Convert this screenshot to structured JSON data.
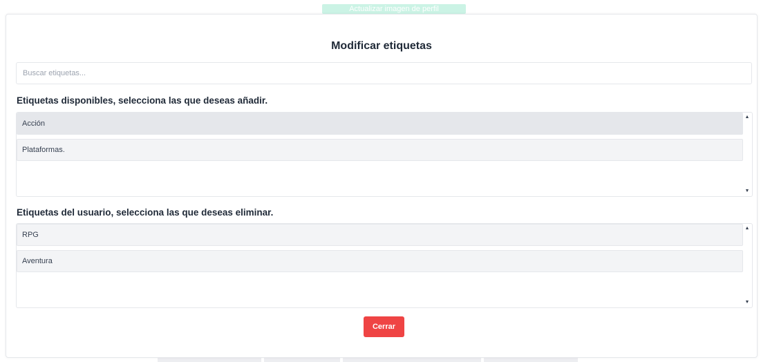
{
  "background": {
    "banner_label": "Actualizar imagen de perfil"
  },
  "modal": {
    "title": "Modificar etiquetas",
    "search": {
      "placeholder": "Buscar etiquetas...",
      "value": ""
    },
    "available": {
      "heading": "Etiquetas disponibles, selecciona las que deseas añadir.",
      "items": [
        {
          "label": "Acción",
          "selected": true
        },
        {
          "label": "Plataformas.",
          "selected": false
        }
      ]
    },
    "user": {
      "heading": "Etiquetas del usuario, selecciona las que deseas eliminar.",
      "items": [
        {
          "label": "RPG",
          "selected": false
        },
        {
          "label": "Aventura",
          "selected": false
        }
      ]
    },
    "close_label": "Cerrar"
  },
  "icons": {
    "scroll_up": "scroll-up-arrow-icon",
    "scroll_down": "scroll-down-arrow-icon"
  },
  "colors": {
    "close_button": "#ef4444",
    "item_bg": "#f3f4f6",
    "item_selected_bg": "#e5e7eb",
    "banner": "#34d399"
  }
}
